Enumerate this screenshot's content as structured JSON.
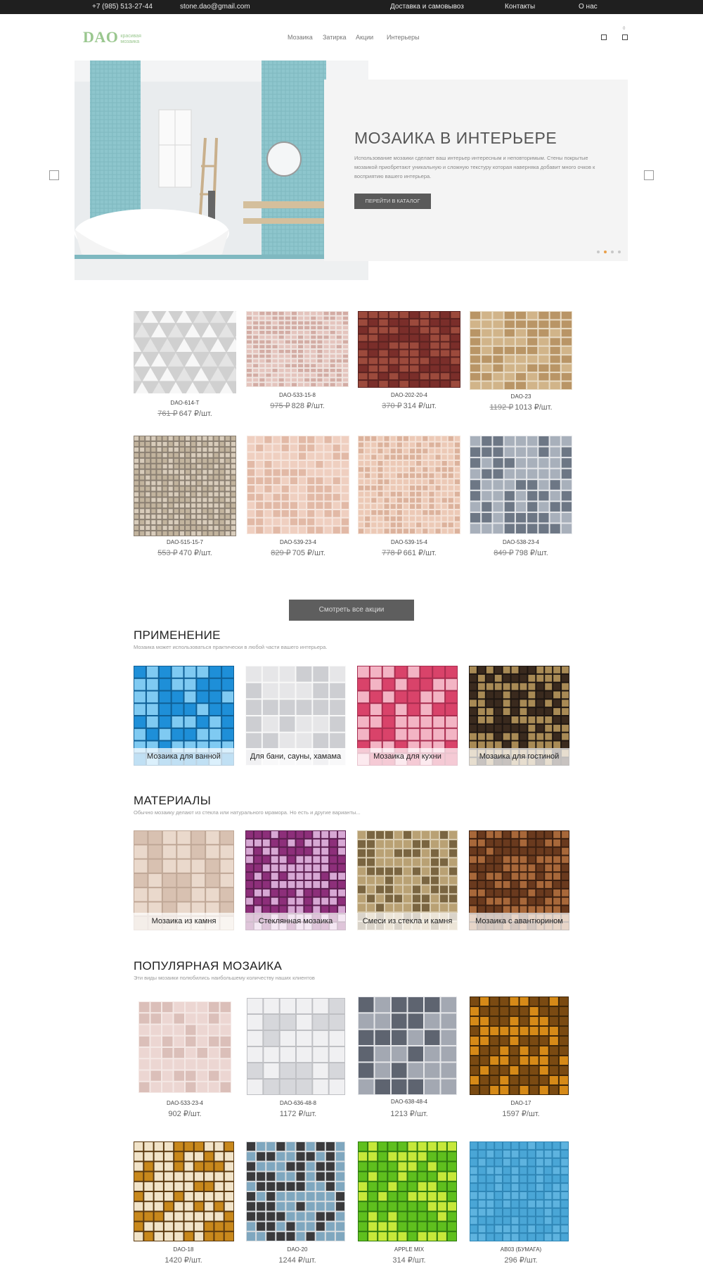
{
  "topbar": {
    "phone": "+7 (985) 513-27-44",
    "email": "stone.dao@gmail.com",
    "links": [
      "Доставка и самовывоз",
      "Контакты",
      "О нас"
    ]
  },
  "header": {
    "logo": "DAO",
    "logo_tagline": "красивая мозаика",
    "nav": [
      "Мозаика",
      "Затирка",
      "Акции",
      "Интерьеры"
    ],
    "cart_count": "0"
  },
  "hero": {
    "title": "МОЗАИКА В ИНТЕРЬЕРЕ",
    "text": "Использование мозаики сделает ваш интерьер интересным и неповторимым. Стены покрытые мозаикой приобретают уникальную и сложную текстуру которая наверняка добавит много очков к восприятию вашего интерьера.",
    "button": "ПЕРЕЙТИ В КАТАЛОГ",
    "slides_total": 4,
    "active_slide": 2
  },
  "sale": [
    {
      "name": "DAO-614-T",
      "old": "761 ₽",
      "price": "647 ₽/шт."
    },
    {
      "name": "DAO-533-15-8",
      "old": "975 ₽",
      "price": "828 ₽/шт."
    },
    {
      "name": "DAO-202-20-4",
      "old": "370 ₽",
      "price": "314 ₽/шт."
    },
    {
      "name": "DAO-23",
      "old": "1192 ₽",
      "price": "1013 ₽/шт."
    },
    {
      "name": "DAO-515-15-7",
      "old": "553 ₽",
      "price": "470 ₽/шт."
    },
    {
      "name": "DAO-539-23-4",
      "old": "829 ₽",
      "price": "705 ₽/шт."
    },
    {
      "name": "DAO-539-15-4",
      "old": "778 ₽",
      "price": "661 ₽/шт."
    },
    {
      "name": "DAO-538-23-4",
      "old": "849 ₽",
      "price": "798 ₽/шт."
    }
  ],
  "all_sales_button": "Смотреть все акции",
  "application": {
    "title": "ПРИМЕНЕНИЕ",
    "subtitle": "Мозаика может использоваться практически в любой части вашего интерьера.",
    "items": [
      "Мозаика для ванной",
      "Для бани, сауны, хамама",
      "Мозаика для кухни",
      "Мозаика для гостиной"
    ]
  },
  "materials": {
    "title": "МАТЕРИАЛЫ",
    "subtitle": "Обычно мозаику делают из стекла или натурального мрамора. Но есть и другие варианты...",
    "items": [
      "Мозаика из камня",
      "Стеклянная мозаика",
      "Смеси из стекла и камня",
      "Мозаика с авантюрином"
    ]
  },
  "popular": {
    "title": "ПОПУЛЯРНАЯ МОЗАИКА",
    "subtitle": "Эти виды мозаики полюбились наибольшему количеству наших клиентов",
    "items": [
      {
        "name": "DAO-533-23-4",
        "price": "902 ₽/шт."
      },
      {
        "name": "DAO-636-48-8",
        "price": "1172 ₽/шт."
      },
      {
        "name": "DAO-638-48-4",
        "price": "1213 ₽/шт."
      },
      {
        "name": "DAO-17",
        "price": "1597 ₽/шт."
      },
      {
        "name": "DAO-18",
        "price": "1420 ₽/шт."
      },
      {
        "name": "DAO-20",
        "price": "1244 ₽/шт."
      },
      {
        "name": "APPLE MIX",
        "price": "314 ₽/шт."
      },
      {
        "name": "AB03 (БУМАГА)",
        "price": "296 ₽/шт."
      }
    ]
  },
  "colors": {
    "topbar": "#1f1f1f",
    "logo": "#9ac78f",
    "accent_dot": "#e8a04a",
    "button": "#5a5a5a"
  }
}
